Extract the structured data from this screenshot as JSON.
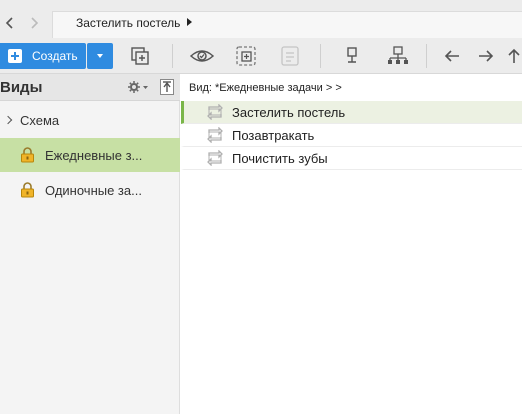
{
  "breadcrumb": {
    "back_icon": "chevron-left-icon",
    "forward_icon": "chevron-right-icon",
    "current": "Застелить постель"
  },
  "toolbar": {
    "create_label": "Создать",
    "icons": [
      "add-icon",
      "dropdown-icon",
      "duplicate-icon",
      "eye-icon",
      "add-subtask-icon",
      "list-icon",
      "single-node-icon",
      "hierarchy-icon",
      "arrow-left-icon",
      "arrow-right-icon",
      "arrow-up-icon"
    ],
    "accent_color": "#2f8be0"
  },
  "left_panel": {
    "title": "Виды",
    "items": [
      {
        "label": "Схема",
        "icon": "chevron-right-icon",
        "selected": false
      },
      {
        "label": "Ежедневные з...",
        "icon": "lock-icon",
        "selected": true
      },
      {
        "label": "Одиночные за...",
        "icon": "lock-icon",
        "selected": false
      }
    ],
    "selected_color": "#c7e0a4"
  },
  "right_panel": {
    "view_header": "Вид: *Ежедневные задачи > >",
    "tasks": [
      {
        "label": "Застелить постель",
        "icon": "recurring-task-icon",
        "selected": true
      },
      {
        "label": "Позавтракать",
        "icon": "recurring-task-icon",
        "selected": false
      },
      {
        "label": "Почистить зубы",
        "icon": "recurring-task-icon",
        "selected": false
      }
    ],
    "selected_accent": "#7ab648"
  }
}
